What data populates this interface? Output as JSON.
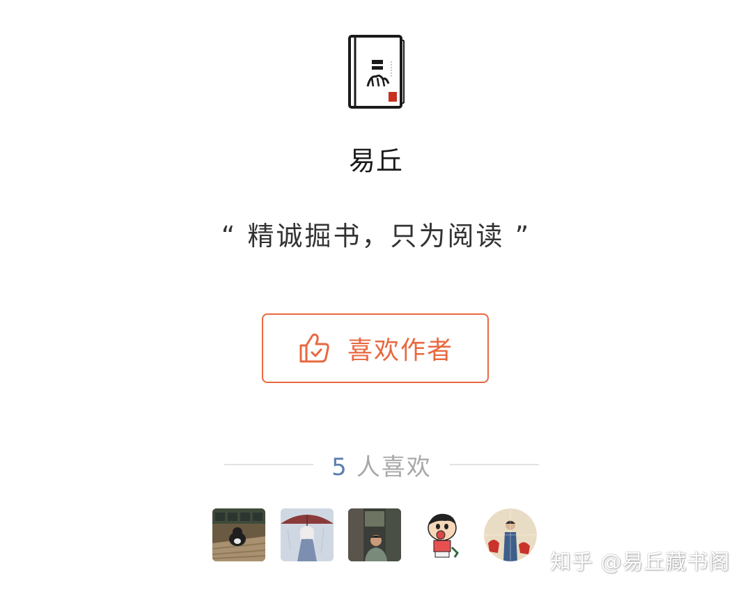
{
  "author": {
    "name": "易丘",
    "motto": "“ 精诚掘书，只为阅读 ”"
  },
  "like_button": {
    "label": "喜欢作者",
    "icon": "thumbs-up-icon",
    "color": "#e8683f"
  },
  "likes": {
    "count": "5",
    "suffix": "人喜欢",
    "count_color": "#5a7eae"
  },
  "likers": [
    {
      "avatar": "cat-photo-avatar"
    },
    {
      "avatar": "umbrella-illustration-avatar"
    },
    {
      "avatar": "man-portrait-avatar"
    },
    {
      "avatar": "cartoon-boy-avatar"
    },
    {
      "avatar": "poster-art-avatar"
    }
  ],
  "watermark": {
    "text": "知乎 @易丘藏书阁"
  }
}
